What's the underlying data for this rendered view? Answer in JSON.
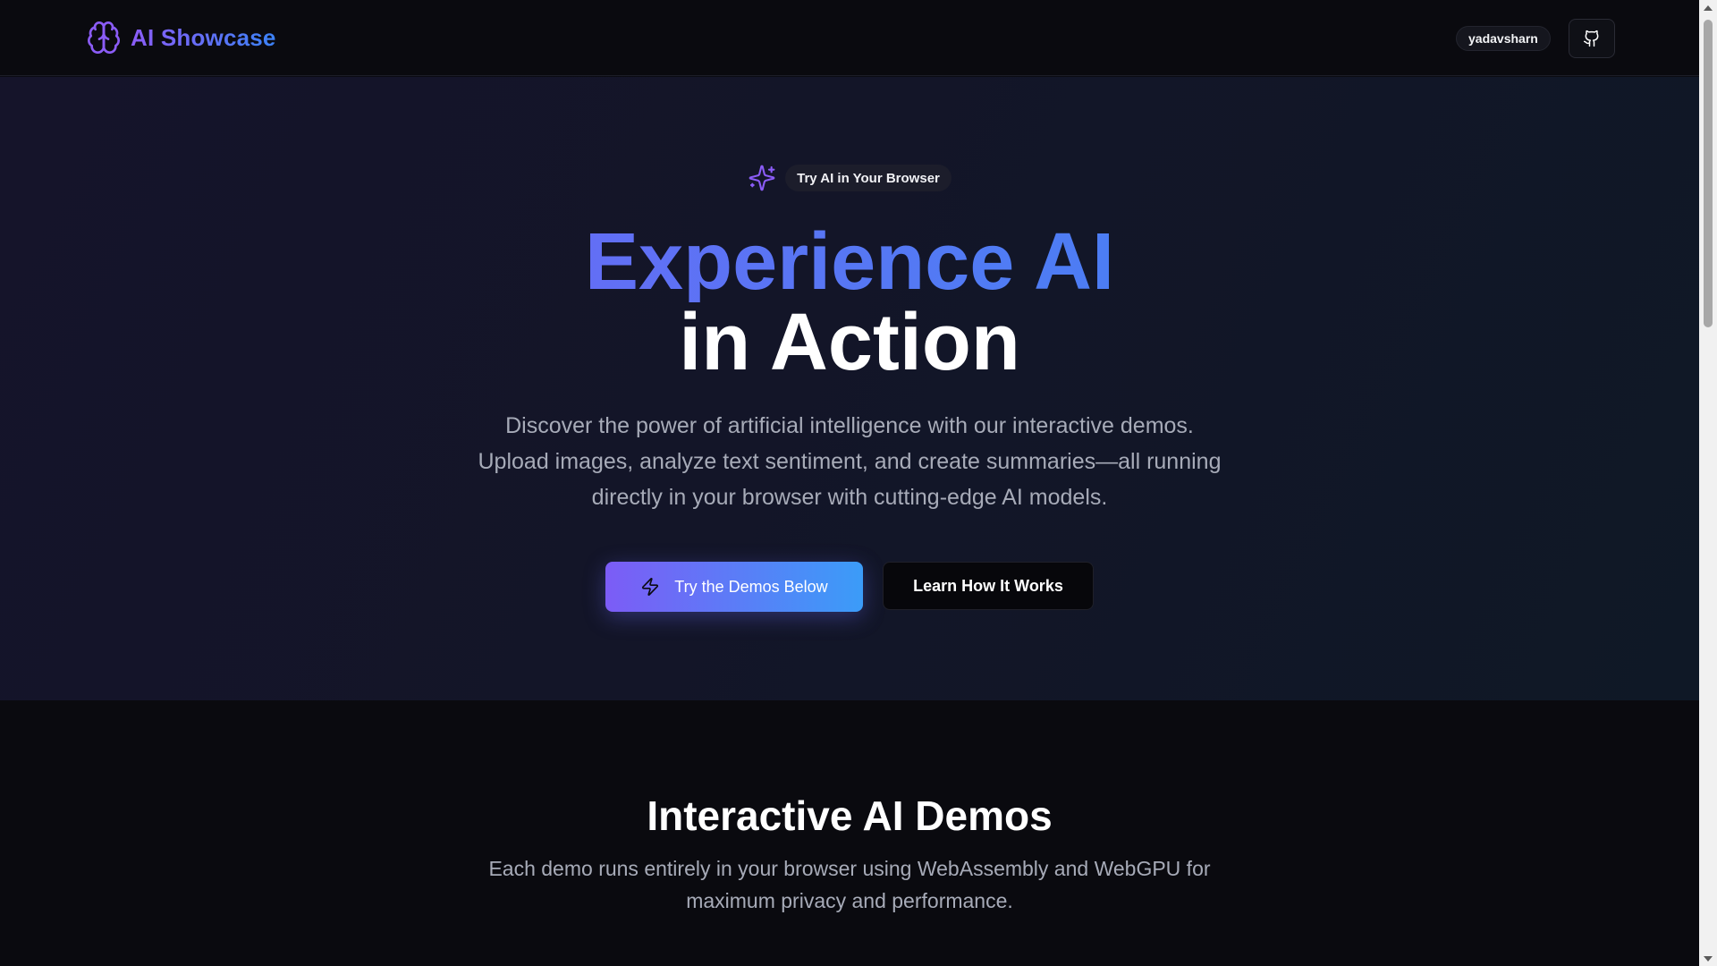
{
  "header": {
    "brand_name": "AI Showcase",
    "brand_icon": "brain-icon",
    "username": "yadavsharn",
    "github_icon": "github-icon"
  },
  "hero": {
    "badge_icon": "sparkles-icon",
    "badge_text": "Try AI in Your Browser",
    "headline_line1": "Experience AI",
    "headline_line2": "in Action",
    "description": "Discover the power of artificial intelligence with our interactive demos. Upload images, analyze text sentiment, and create summaries—all running directly in your browser with cutting-edge AI models.",
    "primary_button_icon": "zap-icon",
    "primary_button_label": "Try the Demos Below",
    "secondary_button_label": "Learn How It Works"
  },
  "demos": {
    "title": "Interactive AI Demos",
    "description": "Each demo runs entirely in your browser using WebAssembly and WebGPU for maximum privacy and performance."
  },
  "colors": {
    "accent_purple": "#8b5cf6",
    "accent_blue": "#3b82f6",
    "background": "#0a0a0f",
    "muted_text": "#a7abb8"
  }
}
